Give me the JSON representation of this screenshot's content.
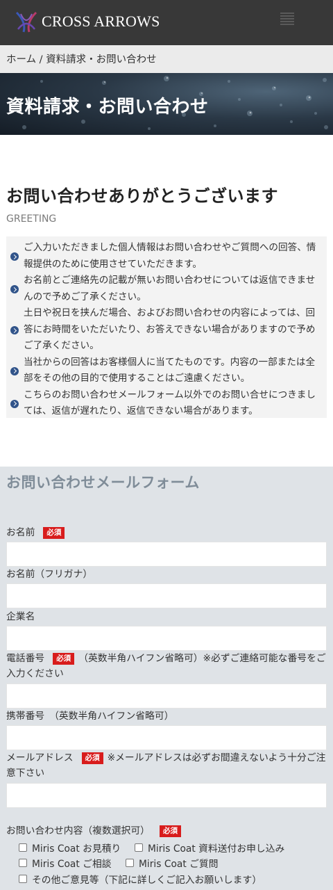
{
  "header": {
    "brand": "CROSS ARROWS"
  },
  "breadcrumb": {
    "home": "ホーム",
    "separator": " / ",
    "current": "資料請求・お問い合わせ"
  },
  "hero": {
    "title": "資料請求・お問い合わせ"
  },
  "greeting": {
    "title": "お問い合わせありがとうございます",
    "subtitle": "GREETING",
    "items": [
      "ご入力いただきました個人情報はお問い合わせやご質問への回答、情報提供のために使用させていただきます。",
      "お名前とご連絡先の記載が無いお問い合わせについては返信できませんので予めご了承ください。",
      "土日や祝日を挟んだ場合、およびお問い合わせの内容によっては、回答にお時間をいただいたり、お答えできない場合がありますので予めご了承ください。",
      "当社からの回答はお客様個人に当てたものです。内容の一部または全部をその他の目的で使用することはご遠慮ください。",
      "こちらのお問い合わせメールフォーム以外でのお問い合せにつきましては、返信が遅れたり、返信できない場合があります。"
    ]
  },
  "form": {
    "title": "お問い合わせメールフォーム",
    "required_badge": "必須",
    "name_label": "お名前",
    "kana_label": "お名前（フリガナ）",
    "company_label": "企業名",
    "phone_label": "電話番号",
    "phone_note": "（英数半角ハイフン省略可）※必ずご連絡可能な番号をご入力ください",
    "mobile_label": "携帯番号　（英数半角ハイフン省略可）",
    "email_label": "メールアドレス",
    "email_note": "※メールアドレスは必ずお間違えないよう十分ご注意下さい",
    "inquiry_label": "お問い合わせ内容（複数選択可）",
    "options": [
      "Miris Coat お見積り",
      "Miris Coat 資料送付お申し込み",
      "Miris Coat ご相談",
      "Miris Coat ご質問",
      "その他ご意見等（下記に詳しくご記入お願いします）"
    ]
  },
  "colors": {
    "header_bg": "#383838",
    "breadcrumb_bg": "#ebebeb",
    "form_bg": "#dfe3e7",
    "required_badge": "#d81c1c",
    "bullet": "#31548a"
  }
}
